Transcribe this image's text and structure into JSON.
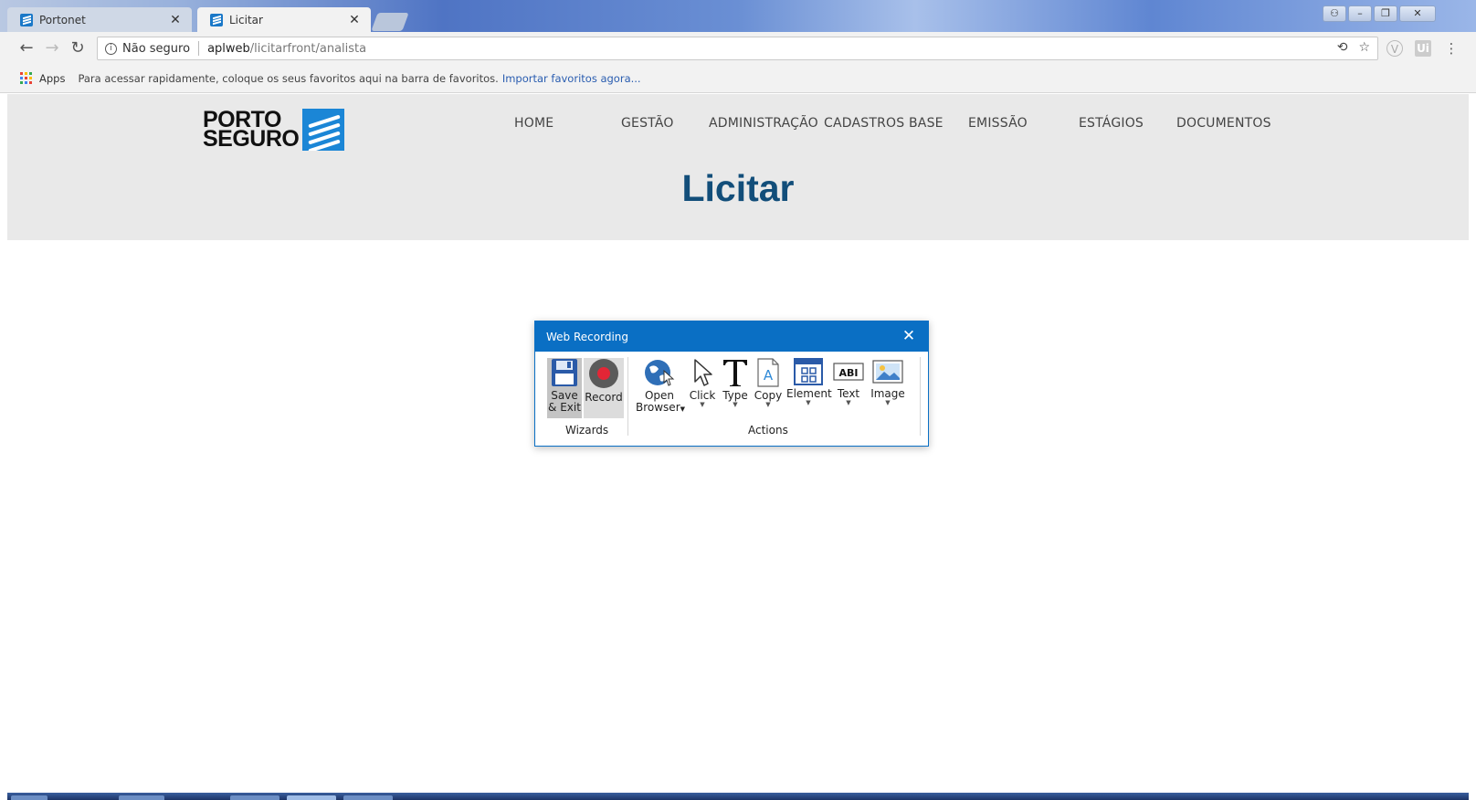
{
  "browser": {
    "tabs": [
      {
        "title": "Portonet",
        "active": false
      },
      {
        "title": "Licitar",
        "active": true
      }
    ],
    "omnibox": {
      "security_text": "Não seguro",
      "url_host": "aplweb",
      "url_path": "/licitarfront/analista"
    },
    "bookmarks_bar": {
      "apps_label": "Apps",
      "hint": "Para acessar rapidamente, coloque os seus favoritos aqui na barra de favoritos.",
      "import_link": "Importar favoritos agora..."
    }
  },
  "site": {
    "logo": {
      "line1": "PORTO",
      "line2": "SEGURO"
    },
    "nav": [
      "HOME",
      "GESTÃO",
      "ADMINISTRAÇÃO",
      "CADASTROS BASE",
      "EMISSÃO",
      "ESTÁGIOS",
      "DOCUMENTOS"
    ],
    "page_title": "Licitar"
  },
  "dialog": {
    "title": "Web Recording",
    "wizards": {
      "group_label": "Wizards",
      "save_line1": "Save",
      "save_line2": "& Exit",
      "record": "Record"
    },
    "actions": {
      "group_label": "Actions",
      "open_line1": "Open",
      "open_line2": "Browser",
      "click": "Click",
      "type": "Type",
      "copy": "Copy",
      "element": "Element",
      "text": "Text",
      "image": "Image",
      "text_icon_glyph": "ABI"
    }
  },
  "colors": {
    "dialog_accent": "#0a6fc4",
    "page_title": "#124e7a",
    "header_bg": "#e9e9e9",
    "logo_blue": "#1b86d6",
    "record_red": "#e32636"
  }
}
